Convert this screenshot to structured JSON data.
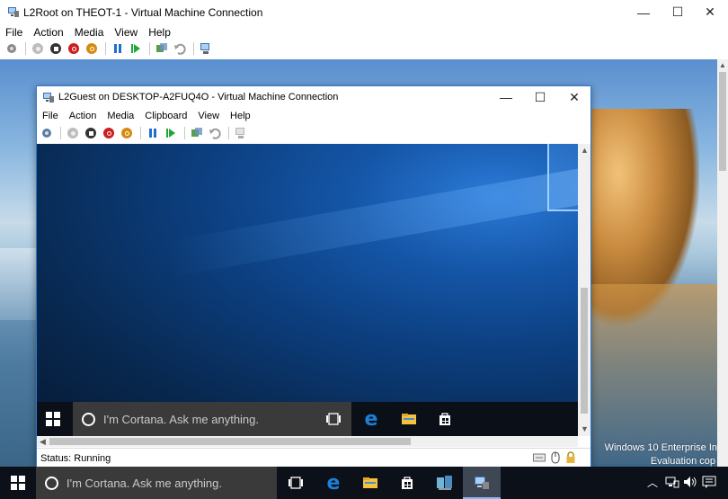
{
  "host": {
    "title": "L2Root on THEOT-1 - Virtual Machine Connection",
    "menu": [
      "File",
      "Action",
      "Media",
      "View",
      "Help"
    ],
    "window_controls": [
      "—",
      "☐",
      "✕"
    ],
    "taskbar": {
      "search_placeholder": "I'm Cortana. Ask me anything."
    },
    "watermark": {
      "line1": "Windows 10 Enterprise In",
      "line2": "Evaluation cop"
    }
  },
  "guest": {
    "title": "L2Guest on DESKTOP-A2FUQ4O - Virtual Machine Connection",
    "menu": [
      "File",
      "Action",
      "Media",
      "Clipboard",
      "View",
      "Help"
    ],
    "window_controls": [
      "—",
      "☐",
      "✕"
    ],
    "taskbar": {
      "search_placeholder": "I'm Cortana. Ask me anything."
    },
    "status": "Status: Running"
  },
  "colors": {
    "start_red": "#cc1f1f",
    "shutdown_orange": "#d68a10",
    "pause_blue": "#1f6fd0",
    "play_green": "#1fa83a",
    "edge_blue": "#1e7fd6",
    "folder_yellow": "#f3c33b"
  }
}
